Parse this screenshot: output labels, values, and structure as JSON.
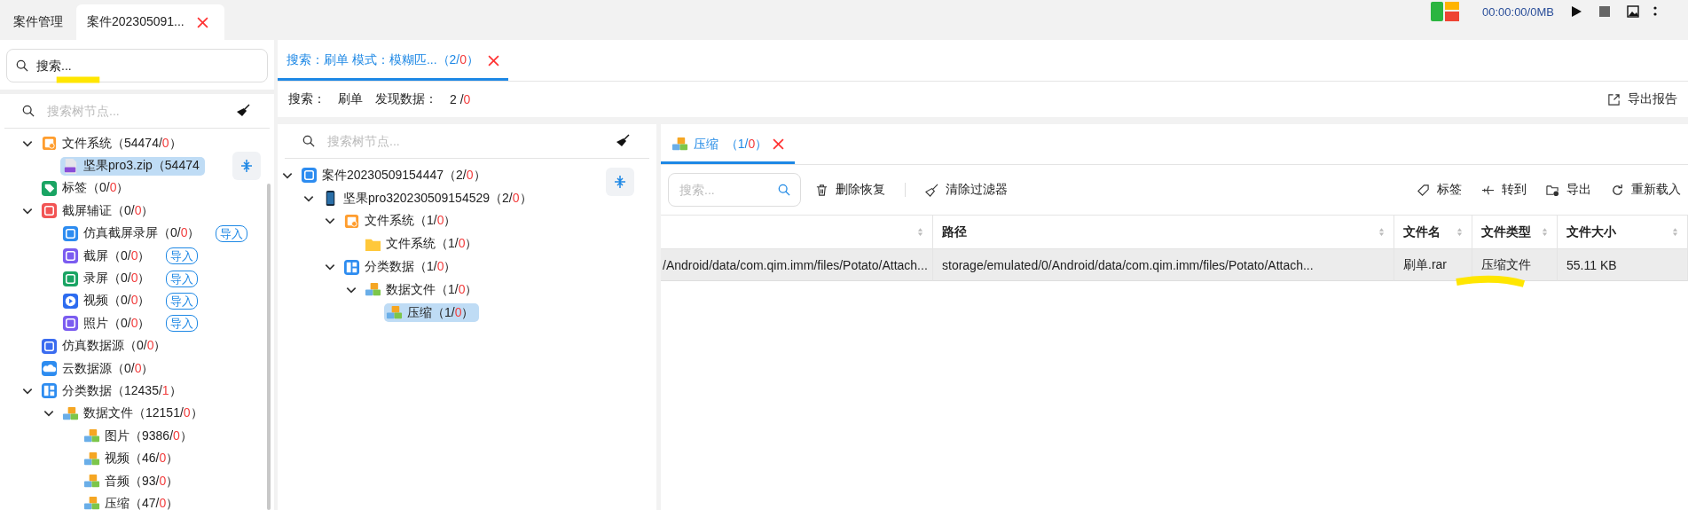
{
  "tabs": [
    {
      "label": "案件管理",
      "selected": false,
      "closable": false
    },
    {
      "label": "案件202305091...",
      "selected": true,
      "closable": true
    }
  ],
  "recorder": {
    "time": "00:00:00/0MB"
  },
  "left_panel": {
    "search": {
      "placeholder": "搜索..."
    },
    "tree_search": {
      "placeholder": "搜索树节点..."
    },
    "tree": [
      {
        "kind": "drive",
        "label": "文件系统",
        "count": "（54474/",
        "flagged": "0",
        "close": "）",
        "expanded": true,
        "selected": false,
        "children": [
          {
            "kind": "zip",
            "label": "坚果pro3.zip（54474",
            "selected": true
          }
        ]
      },
      {
        "kind": "tag",
        "label": "标签",
        "count": "（0/",
        "flagged": "0",
        "close": "）",
        "selected": false
      },
      {
        "kind": "camera",
        "label": "截屏辅证",
        "count": "（0/",
        "flagged": "0",
        "close": "）",
        "expanded": true,
        "selected": false,
        "children": [
          {
            "kind": "sim-record",
            "label": "仿真截屏录屏",
            "count": "（0/",
            "flagged": "0",
            "close": "）",
            "action": "导入",
            "selected": false
          },
          {
            "kind": "capture",
            "label": "截屏",
            "count": "（0/",
            "flagged": "0",
            "close": "）",
            "action": "导入",
            "selected": false
          },
          {
            "kind": "screen-record",
            "label": "录屏",
            "count": "（0/",
            "flagged": "0",
            "close": "）",
            "action": "导入",
            "selected": false
          },
          {
            "kind": "video",
            "label": "视频",
            "count": "（0/",
            "flagged": "0",
            "close": "）",
            "action": "导入",
            "selected": false
          },
          {
            "kind": "photo",
            "label": "照片",
            "count": "（0/",
            "flagged": "0",
            "close": "）",
            "action": "导入",
            "selected": false
          }
        ]
      },
      {
        "kind": "sim-source",
        "label": "仿真数据源",
        "count": "（0/",
        "flagged": "0",
        "close": "）",
        "selected": false
      },
      {
        "kind": "cloud",
        "label": "云数据源",
        "count": "（0/",
        "flagged": "0",
        "close": "）",
        "selected": false
      },
      {
        "kind": "category",
        "label": "分类数据",
        "count": "（12435/",
        "flagged": "1",
        "close": "）",
        "expanded": true,
        "selected": false,
        "children": [
          {
            "kind": "boxes",
            "label": "数据文件",
            "count": "（12151/",
            "flagged": "0",
            "close": "）",
            "expanded": true,
            "selected": false,
            "children": [
              {
                "kind": "boxes",
                "label": "图片",
                "count": "（9386/",
                "flagged": "0",
                "close": "）",
                "selected": false
              },
              {
                "kind": "boxes",
                "label": "视频",
                "count": "（46/",
                "flagged": "0",
                "close": "）",
                "selected": false
              },
              {
                "kind": "boxes",
                "label": "音频",
                "count": "（93/",
                "flagged": "0",
                "close": "）",
                "selected": false
              },
              {
                "kind": "boxes",
                "label": "压缩",
                "count": "（47/",
                "flagged": "0",
                "close": "）",
                "selected": false
              }
            ]
          }
        ]
      }
    ]
  },
  "search_tab": {
    "label": "搜索：刷单 模式：模糊匹...",
    "count": "（2/",
    "flagged": "0",
    "close": "）",
    "selected": true
  },
  "summary": {
    "search_label": "搜索：",
    "term": "刷单",
    "found_label": "发现数据：",
    "found": "2 /",
    "flagged": "0",
    "export": "导出报告"
  },
  "middle_tree": {
    "placeholder": "搜索树节点...",
    "tree": [
      {
        "kind": "case",
        "label": "案件20230509154447",
        "count": "（2/",
        "flagged": "0",
        "close": "）",
        "expanded": true,
        "selected": false,
        "children": [
          {
            "kind": "phone",
            "label": "坚果pro320230509154529",
            "count": "（2/",
            "flagged": "0",
            "close": "）",
            "expanded": true,
            "selected": false,
            "children": [
              {
                "kind": "drive",
                "label": "文件系统",
                "count": "（1/",
                "flagged": "0",
                "close": "）",
                "expanded": true,
                "selected": false,
                "children": [
                  {
                    "kind": "folder",
                    "label": "文件系统",
                    "count": "（1/",
                    "flagged": "0",
                    "close": "）",
                    "selected": false
                  }
                ]
              },
              {
                "kind": "category",
                "label": "分类数据",
                "count": "（1/",
                "flagged": "0",
                "close": "）",
                "expanded": true,
                "selected": false,
                "children": [
                  {
                    "kind": "boxes",
                    "label": "数据文件",
                    "count": "（1/",
                    "flagged": "0",
                    "close": "）",
                    "expanded": true,
                    "selected": false,
                    "children": [
                      {
                        "kind": "boxes",
                        "label": "压缩",
                        "count": "（1/",
                        "flagged": "0",
                        "close": "）",
                        "selected": true
                      }
                    ]
                  }
                ]
              }
            ]
          }
        ]
      }
    ]
  },
  "result_tab": {
    "label": "压缩",
    "count": "（1/",
    "flagged": "0",
    "close": "）",
    "selected": true
  },
  "toolbar": {
    "search": {
      "placeholder": "搜索..."
    },
    "left_actions": [
      {
        "kind": "trash",
        "label": "删除恢复"
      },
      {
        "kind": "broom",
        "label": "清除过滤器"
      }
    ],
    "right_actions": [
      {
        "kind": "tag",
        "label": "标签"
      },
      {
        "kind": "jump",
        "label": "转到"
      },
      {
        "kind": "export",
        "label": "导出"
      },
      {
        "kind": "reload",
        "label": "重新载入"
      }
    ]
  },
  "table": {
    "columns": [
      "",
      "路径",
      "文件名",
      "文件类型",
      "文件大小"
    ],
    "rows": [
      {
        "selected": true,
        "cells": [
          "/Android/data/com.qim.imm/files/Potato/Attach...",
          "storage/emulated/0/Android/data/com.qim.imm/files/Potato/Attach...",
          "刷单.rar",
          "压缩文件",
          "55.11 KB"
        ]
      }
    ]
  }
}
